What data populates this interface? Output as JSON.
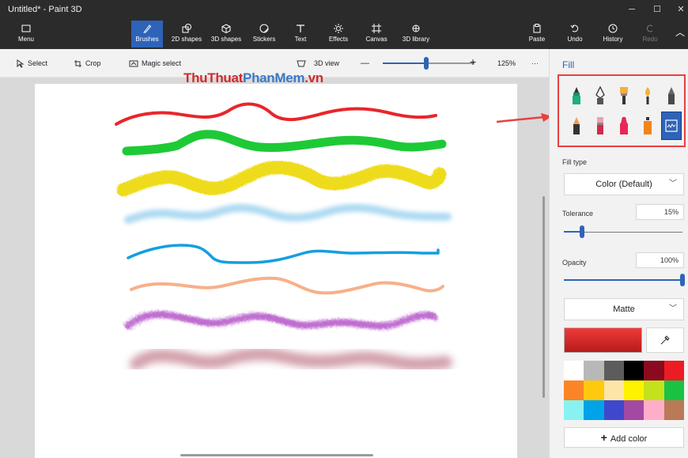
{
  "window": {
    "title": "Untitled* - Paint 3D",
    "controls": [
      "minimize",
      "maximize",
      "close"
    ]
  },
  "toolbar": {
    "menu": "Menu",
    "items": [
      {
        "label": "Brushes",
        "icon": "brush-icon",
        "active": true
      },
      {
        "label": "2D shapes",
        "icon": "2d-shapes-icon"
      },
      {
        "label": "3D shapes",
        "icon": "3d-shapes-icon"
      },
      {
        "label": "Stickers",
        "icon": "stickers-icon"
      },
      {
        "label": "Text",
        "icon": "text-icon"
      },
      {
        "label": "Effects",
        "icon": "effects-icon"
      },
      {
        "label": "Canvas",
        "icon": "canvas-icon"
      },
      {
        "label": "3D library",
        "icon": "3d-library-icon"
      }
    ],
    "right": [
      {
        "label": "Paste",
        "icon": "paste-icon"
      },
      {
        "label": "Undo",
        "icon": "undo-icon"
      },
      {
        "label": "History",
        "icon": "history-icon"
      },
      {
        "label": "Redo",
        "icon": "redo-icon",
        "disabled": true
      }
    ]
  },
  "commandbar": {
    "select": "Select",
    "crop": "Crop",
    "magic_select": "Magic select",
    "view_3d": "3D view",
    "zoom_minus": "—",
    "zoom_plus": "+",
    "zoom_level": "125%",
    "zoom_fraction": 0.47,
    "more": "···"
  },
  "watermark": {
    "part1": "ThuThuat",
    "part2": "PhanMem",
    "part3": ".vn"
  },
  "panel": {
    "title": "Fill",
    "brushes": [
      "marker-icon",
      "calligraphy-pen-icon",
      "oil-brush-icon",
      "watercolor-icon",
      "pencil-icon",
      "eraser-icon",
      "crayon-icon",
      "pixel-pen-icon",
      "spray-can-icon",
      "fill-bucket-icon"
    ],
    "fill_type_label": "Fill type",
    "fill_type_value": "Color (Default)",
    "tolerance_label": "Tolerance",
    "tolerance_value": "15%",
    "tolerance_fraction": 0.15,
    "opacity_label": "Opacity",
    "opacity_value": "100%",
    "opacity_fraction": 1.0,
    "finish_value": "Matte",
    "selected_color": "#e53935",
    "palette": [
      "#ffffff",
      "#b8b8b8",
      "#5c5c5c",
      "#000000",
      "#8b0a1e",
      "#ed1c24",
      "#fb8526",
      "#ffc90e",
      "#fde5a8",
      "#fff200",
      "#c4e11e",
      "#1ac243",
      "#88f2f2",
      "#00a2e8",
      "#3f48cc",
      "#a349a4",
      "#ffaec9",
      "#b97a57"
    ],
    "add_color": "Add color"
  },
  "colors": {
    "accent": "#2e63b8",
    "dark": "#2b2b2b",
    "highlight": "#e84040"
  }
}
